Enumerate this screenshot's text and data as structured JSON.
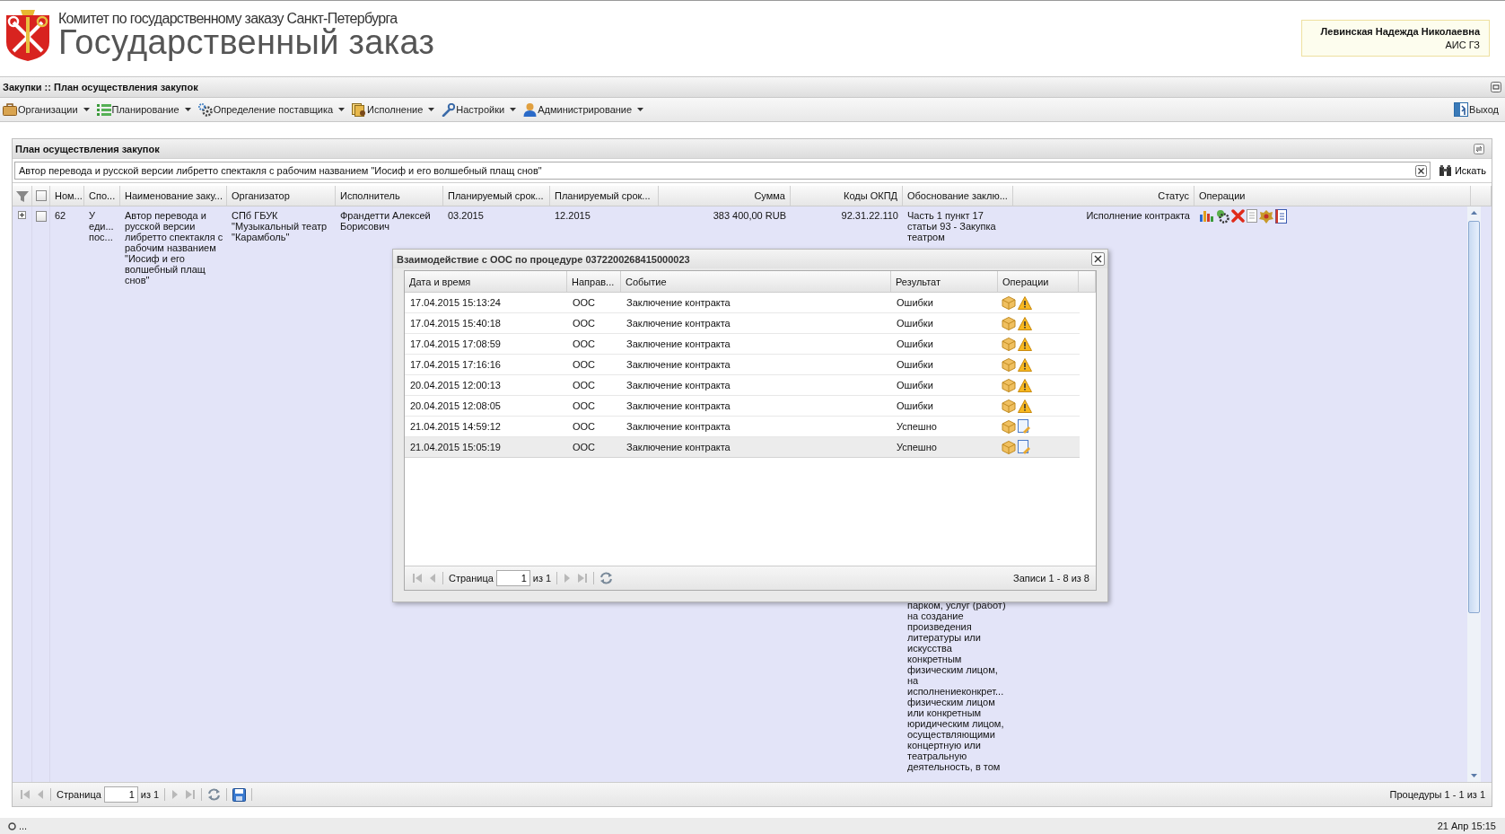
{
  "header": {
    "org_title": "Комитет по государственному заказу Санкт-Петербурга",
    "app_title": "Государственный заказ",
    "user_name": "Левинская Надежда Николаевна",
    "user_system": "АИС ГЗ"
  },
  "breadcrumb": "Закупки :: План осуществления закупок",
  "menu": [
    {
      "label": "Организации",
      "kind": "briefcase"
    },
    {
      "label": "Планирование",
      "kind": "planning"
    },
    {
      "label": "Определение поставщика",
      "kind": "gears"
    },
    {
      "label": "Исполнение",
      "kind": "documents"
    },
    {
      "label": "Настройки",
      "kind": "wrench"
    },
    {
      "label": "Администрирование",
      "kind": "user"
    }
  ],
  "exit_label": "Выход",
  "panel": {
    "title": "План осуществления закупок",
    "search": {
      "value": "Автор перевода и русской версии либретто спектакля с рабочим названием \"Иосиф и его волшебный плащ снов\"",
      "button": "Искать"
    },
    "select_all_checked": false,
    "columns": [
      "Ном...",
      "Спо...",
      "Наименование заку...",
      "Организатор",
      "Исполнитель",
      "Планируемый срок...",
      "Планируемый срок...",
      "Сумма",
      "Коды ОКПД",
      "Обоснование заклю...",
      "Статус",
      "Операции"
    ],
    "rows": [
      {
        "selected": true,
        "expanded": false,
        "checked": false,
        "cells": [
          "62",
          "У\nеди...\nпос...",
          "Автор перевода и\nрусской версии\nлибретто спектакля с\nрабочим названием\n\"Иосиф и его\nволшебный плащ\nснов\"",
          "СПб ГБУК\n\"Музыкальный театр\n\"Карамболь\"",
          "Франдетти Алексей\nБорисович",
          "03.2015",
          "12.2015",
          "383 400,00 RUB",
          "92.31.22.110"
        ],
        "reason_top": "Часть 1 пункт 17\nстатьи 93 - Закупка\nтеатром",
        "reason_bottom": "парком, услуг (работ)\nна создание\nпроизведения\nлитературы или\nискусства\nконкретным\nфизическим лицом,\nна\nисполнениеконкрет...\nфизическим лицом\nили конкретным\nюридическим лицом,\nосуществляющими\nконцертную или\nтеатральную\nдеятельность, в том",
        "status": "Исполнение контракта"
      }
    ],
    "pager": {
      "page_label": "Страница",
      "page": "1",
      "of": "из 1",
      "summary": "Процедуры 1 - 1 из 1"
    }
  },
  "dialog": {
    "title": "Взаимодействие с ООС по процедуре 0372200268415000023",
    "columns": [
      "Дата и время",
      "Направ...",
      "Событие",
      "Результат",
      "Операции"
    ],
    "rows": [
      {
        "datetime": "17.04.2015 15:13:24",
        "direction": "ООС",
        "event": "Заключение контракта",
        "result": "Ошибки",
        "kind": "error",
        "selected": false
      },
      {
        "datetime": "17.04.2015 15:40:18",
        "direction": "ООС",
        "event": "Заключение контракта",
        "result": "Ошибки",
        "kind": "error",
        "selected": false
      },
      {
        "datetime": "17.04.2015 17:08:59",
        "direction": "ООС",
        "event": "Заключение контракта",
        "result": "Ошибки",
        "kind": "error",
        "selected": false
      },
      {
        "datetime": "17.04.2015 17:16:16",
        "direction": "ООС",
        "event": "Заключение контракта",
        "result": "Ошибки",
        "kind": "error",
        "selected": false
      },
      {
        "datetime": "20.04.2015 12:00:13",
        "direction": "ООС",
        "event": "Заключение контракта",
        "result": "Ошибки",
        "kind": "error",
        "selected": false
      },
      {
        "datetime": "20.04.2015 12:08:05",
        "direction": "ООС",
        "event": "Заключение контракта",
        "result": "Ошибки",
        "kind": "error",
        "selected": false
      },
      {
        "datetime": "21.04.2015 14:59:12",
        "direction": "ООС",
        "event": "Заключение контракта",
        "result": "Успешно",
        "kind": "success",
        "selected": false
      },
      {
        "datetime": "21.04.2015 15:05:19",
        "direction": "ООС",
        "event": "Заключение контракта",
        "result": "Успешно",
        "kind": "success",
        "selected": true
      }
    ],
    "pager": {
      "page_label": "Страница",
      "page": "1",
      "of": "из 1",
      "summary": "Записи 1 - 8 из 8"
    }
  },
  "status_bar": {
    "left": "...",
    "right": "21 Апр 15:15"
  }
}
